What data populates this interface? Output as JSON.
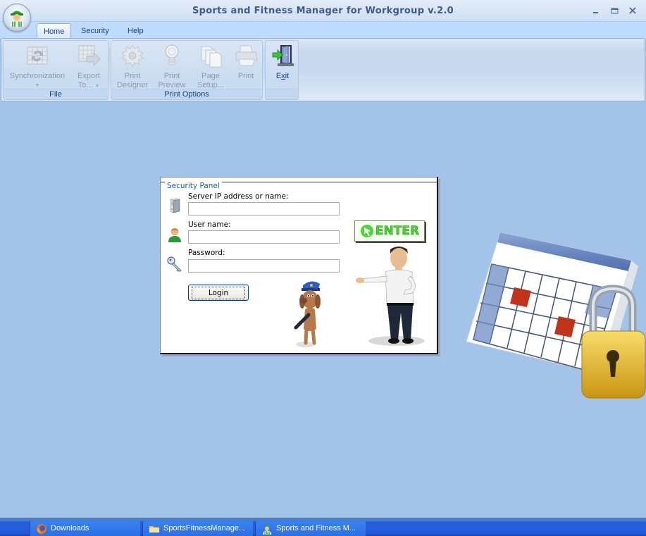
{
  "window": {
    "title": "Sports and Fitness Manager for Workgroup v.2.0",
    "controls": {
      "minimize": "_",
      "maximize": "▭",
      "close": "X"
    }
  },
  "ribbon": {
    "tabs": [
      {
        "label": "Home",
        "active": true
      },
      {
        "label": "Security",
        "active": false
      },
      {
        "label": "Help",
        "active": false
      }
    ],
    "groups": {
      "file": {
        "label": "File",
        "buttons": [
          {
            "label": "Synchronization",
            "icon": "sync-table-icon",
            "enabled": false,
            "dropdown": true
          },
          {
            "label_line1": "Export",
            "label_line2": "To...",
            "icon": "export-table-icon",
            "enabled": false,
            "dropdown": true
          }
        ]
      },
      "print_options": {
        "label": "Print Options",
        "buttons": [
          {
            "label_line1": "Print",
            "label_line2": "Designer",
            "icon": "gear-icon",
            "enabled": false
          },
          {
            "label_line1": "Print",
            "label_line2": "Preview",
            "icon": "bulb-icon",
            "enabled": false
          },
          {
            "label_line1": "Page",
            "label_line2": "Setup...",
            "icon": "pages-icon",
            "enabled": false
          },
          {
            "label": "Print",
            "icon": "printer-icon",
            "enabled": false
          }
        ]
      },
      "exit": {
        "label": "",
        "buttons": [
          {
            "label": "Exit",
            "mnemonic": "x",
            "icon": "exit-door-icon",
            "enabled": true
          }
        ]
      }
    }
  },
  "security_panel": {
    "legend": "Security Panel",
    "server": {
      "label": "Server IP address or name:",
      "value": "",
      "icon": "server-icon"
    },
    "username": {
      "label": "User name:",
      "value": "",
      "icon": "user-icon"
    },
    "password": {
      "label": "Password:",
      "value": "",
      "icon": "key-icon"
    },
    "login_label": "Login",
    "enter_sign": "ENTER"
  },
  "taskbar": {
    "items": [
      {
        "label": "Downloads",
        "icon": "firefox-icon"
      },
      {
        "label": "SportsFitnessManage...",
        "icon": "folder-icon"
      },
      {
        "label": "Sports and Fitness M...",
        "icon": "app-icon"
      }
    ]
  },
  "colors": {
    "desktop_bg": "#a4c3e8",
    "ribbon_text": "#15428b",
    "title_text": "#3e5c8a",
    "taskbar": "#245edb"
  }
}
